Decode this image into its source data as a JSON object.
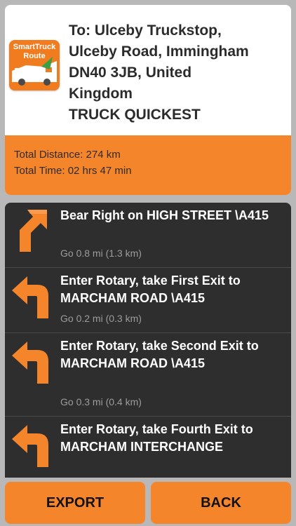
{
  "header": {
    "logo_text_line1": "SmartTruck",
    "logo_text_line2": "Route",
    "destination_lines": [
      "To: Ulceby Truckstop,",
      "Ulceby Road, Immingham",
      "DN40 3JB, United",
      "Kingdom",
      "TRUCK QUICKEST"
    ]
  },
  "summary": {
    "total_distance": "Total Distance: 274 km",
    "total_time": "Total Time: 02 hrs 47 min"
  },
  "directions": [
    {
      "icon": "bear-right-arrow-icon",
      "instruction": "Bear Right on HIGH STREET \\A415",
      "distance": "Go 0.8 mi  (1.3 km)"
    },
    {
      "icon": "turn-left-arrow-icon",
      "instruction": "Enter Rotary, take First Exit to MARCHAM ROAD \\A415",
      "distance": "Go 0.2 mi  (0.3 km)"
    },
    {
      "icon": "turn-left-arrow-icon",
      "instruction": "Enter Rotary, take Second Exit to MARCHAM ROAD \\A415",
      "distance": "Go 0.3 mi  (0.4 km)"
    },
    {
      "icon": "turn-left-arrow-icon",
      "instruction": "Enter Rotary, take Fourth Exit to MARCHAM INTERCHANGE",
      "distance": ""
    }
  ],
  "buttons": {
    "export": "EXPORT",
    "back": "BACK"
  },
  "colors": {
    "accent": "#f5852a",
    "list_background": "#2e2e2e",
    "page_background": "#b8b8b8"
  }
}
